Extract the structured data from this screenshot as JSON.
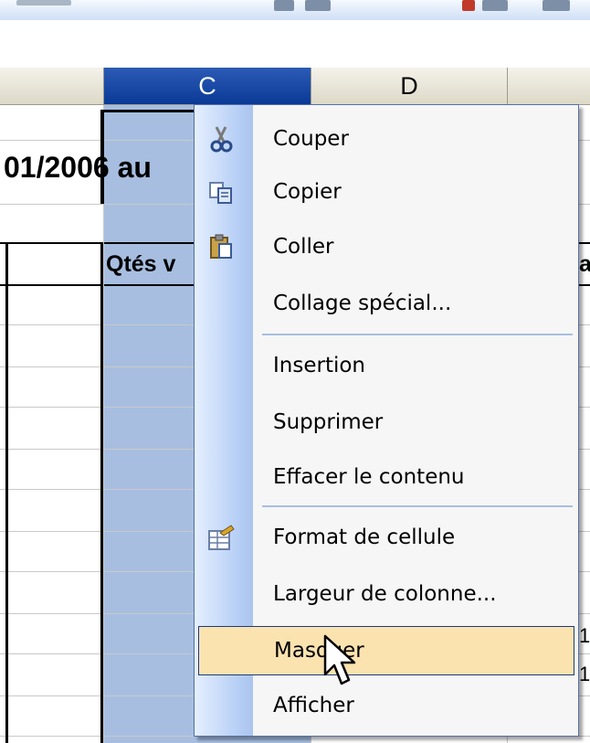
{
  "columns": [
    {
      "label": ""
    },
    {
      "label": "C"
    },
    {
      "label": "D"
    },
    {
      "label": ""
    }
  ],
  "cells": {
    "date": "01/2006 au",
    "qtes": "Qtés v",
    "right_a": "a",
    "right_1a": "1",
    "right_1b": "1"
  },
  "context_menu": {
    "items": [
      {
        "label": "Couper",
        "icon": "scissors-icon"
      },
      {
        "label": "Copier",
        "icon": "copy-icon"
      },
      {
        "label": "Coller",
        "icon": "paste-icon"
      },
      {
        "label": "Collage spécial...",
        "icon": ""
      },
      {
        "label": "Insertion",
        "icon": ""
      },
      {
        "label": "Supprimer",
        "icon": ""
      },
      {
        "label": "Effacer le contenu",
        "icon": ""
      },
      {
        "label": "Format de cellule",
        "icon": "format-cells-icon"
      },
      {
        "label": "Largeur de colonne...",
        "icon": ""
      },
      {
        "label": "Masquer",
        "icon": "",
        "highlighted": true
      },
      {
        "label": "Afficher",
        "icon": ""
      }
    ]
  },
  "colors": {
    "selected_column_header": "#0a3a96",
    "selected_column_fill": "#a7bee0",
    "menu_highlight": "#fbe3b0"
  }
}
